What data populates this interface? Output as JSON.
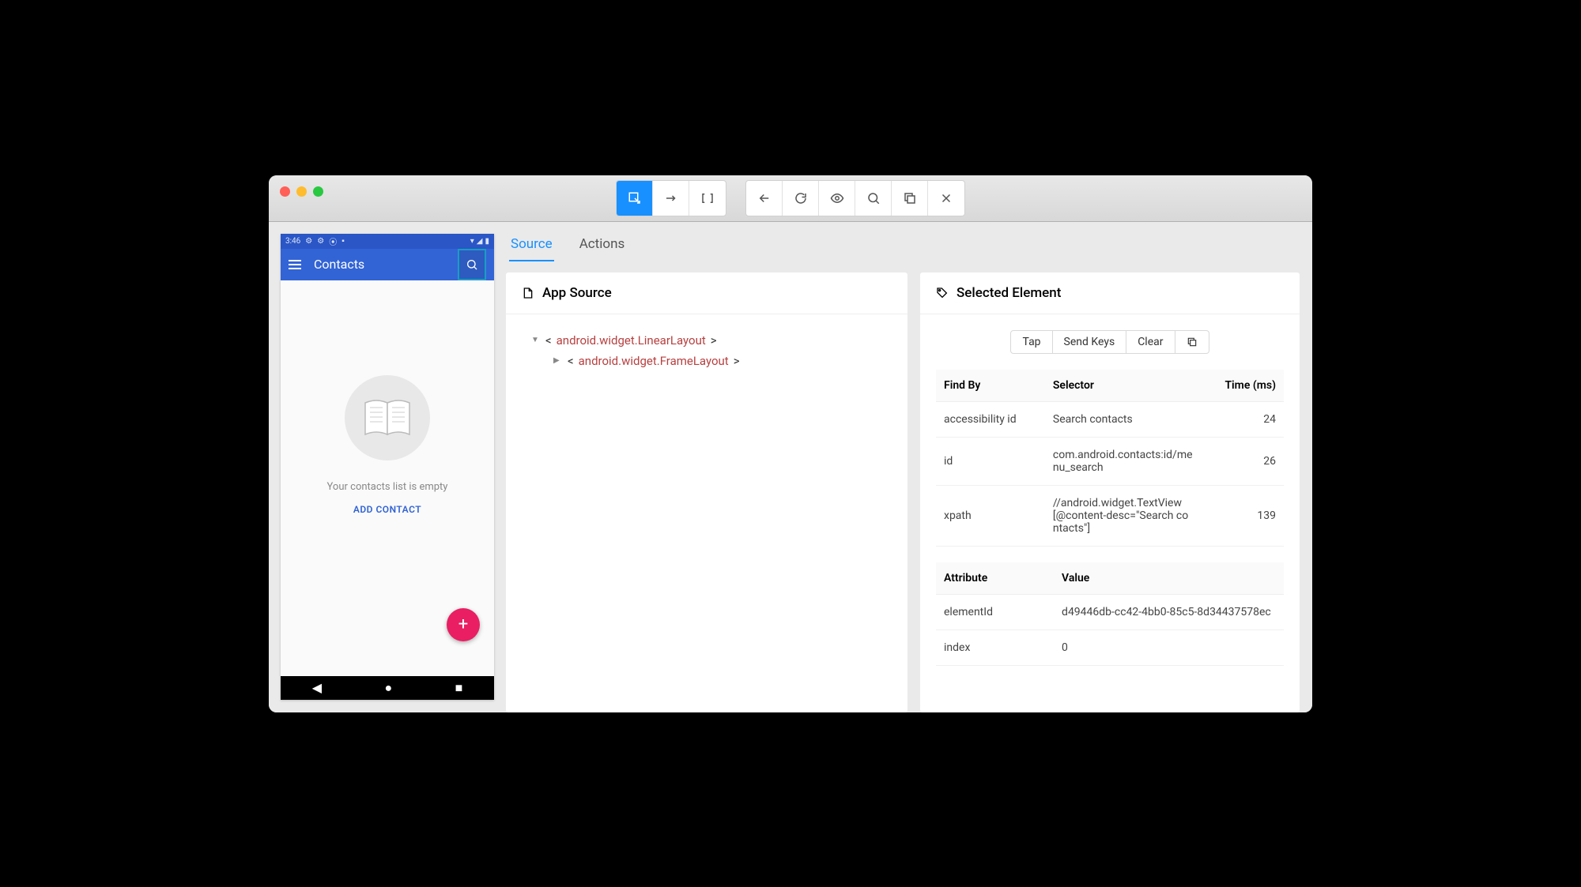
{
  "device": {
    "status_time": "3:46",
    "app_title": "Contacts",
    "empty_msg": "Your contacts list is empty",
    "add_label": "ADD CONTACT"
  },
  "tabs": {
    "source": "Source",
    "actions": "Actions"
  },
  "source_panel": {
    "title": "App Source",
    "tree": {
      "n0": "android.widget.LinearLayout",
      "n1": "android.widget.FrameLayout"
    }
  },
  "selected_panel": {
    "title": "Selected Element",
    "actions": {
      "tap": "Tap",
      "send": "Send Keys",
      "clear": "Clear"
    },
    "findby_headers": {
      "c0": "Find By",
      "c1": "Selector",
      "c2": "Time (ms)"
    },
    "findby_rows": [
      {
        "by": "accessibility id",
        "sel": "Search contacts",
        "ms": "24"
      },
      {
        "by": "id",
        "sel": "com.android.contacts:id/menu_search",
        "ms": "26"
      },
      {
        "by": "xpath",
        "sel": "//android.widget.TextView[@content-desc=\"Search contacts\"]",
        "ms": "139"
      }
    ],
    "attr_headers": {
      "c0": "Attribute",
      "c1": "Value"
    },
    "attr_rows": [
      {
        "k": "elementId",
        "v": "d49446db-cc42-4bb0-85c5-8d34437578ec"
      },
      {
        "k": "index",
        "v": "0"
      }
    ]
  }
}
